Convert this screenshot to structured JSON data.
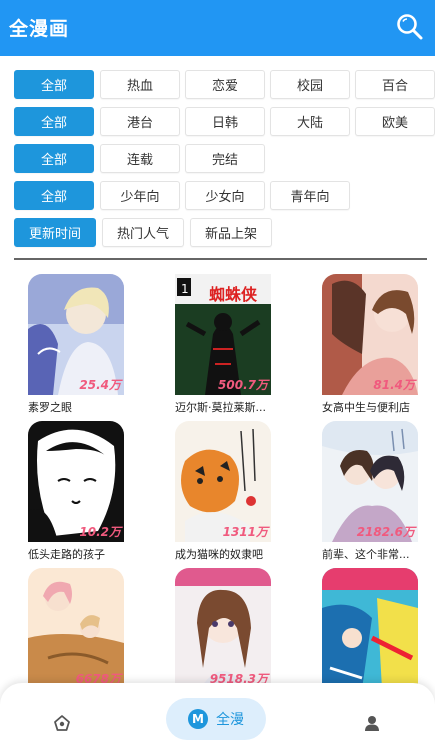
{
  "header": {
    "title": "全漫画",
    "search_icon": "search-icon"
  },
  "filters": [
    {
      "row": "genre",
      "options": [
        "全部",
        "热血",
        "恋爱",
        "校园",
        "百合"
      ],
      "selected": 0
    },
    {
      "row": "region",
      "options": [
        "全部",
        "港台",
        "日韩",
        "大陆",
        "欧美"
      ],
      "selected": 0
    },
    {
      "row": "status",
      "options": [
        "全部",
        "连载",
        "完结"
      ],
      "selected": 0
    },
    {
      "row": "audience",
      "options": [
        "全部",
        "少年向",
        "少女向",
        "青年向"
      ],
      "selected": 0
    },
    {
      "row": "sort",
      "options": [
        "更新时间",
        "热门人气",
        "新品上架"
      ],
      "selected": 0
    }
  ],
  "comics": [
    {
      "title": "素罗之眼",
      "views": "25.4万"
    },
    {
      "title": "迈尔斯·莫拉莱斯...",
      "views": "500.7万",
      "cover_text": "蜘蛛侠"
    },
    {
      "title": "女高中生与便利店",
      "views": "81.4万"
    },
    {
      "title": "低头走路的孩子",
      "views": "10.2万"
    },
    {
      "title": "成为猫咪的奴隶吧",
      "views": "1311万"
    },
    {
      "title": "前辈、这个非常...",
      "views": "2182.6万"
    },
    {
      "title": "",
      "views": "6678万"
    },
    {
      "title": "",
      "views": "9518.3万"
    },
    {
      "title": "",
      "views": ""
    }
  ],
  "tabbar": {
    "items": [
      {
        "icon": "home-icon"
      },
      {
        "icon": "m-icon",
        "label": "全漫",
        "badge": "M"
      },
      {
        "icon": "user-icon"
      }
    ]
  },
  "colors": {
    "primary": "#2196f3",
    "chip_active": "#1e96dc",
    "view_count": "#f05a7e"
  }
}
